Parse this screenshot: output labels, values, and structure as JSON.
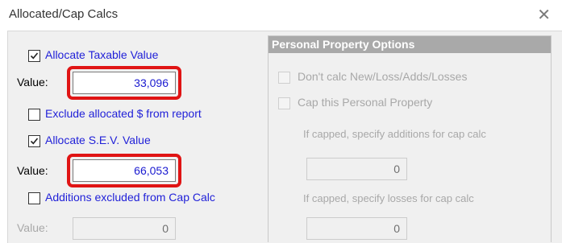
{
  "window": {
    "title": "Allocated/Cap Calcs",
    "close_glyph": "✕"
  },
  "left": {
    "allocate_taxable": {
      "label": "Allocate Taxable Value",
      "checked": true
    },
    "taxable_value": {
      "label": "Value:",
      "value": "33,096"
    },
    "exclude_allocated": {
      "label": "Exclude allocated $ from report",
      "checked": false
    },
    "allocate_sev": {
      "label": "Allocate S.E.V. Value",
      "checked": true
    },
    "sev_value": {
      "label": "Value:",
      "value": "66,053"
    },
    "additions_excluded": {
      "label": "Additions excluded from Cap Calc",
      "checked": false
    },
    "additions_value": {
      "label": "Value:",
      "value": "0"
    }
  },
  "personal_property": {
    "title": "Personal Property Options",
    "dont_calc": {
      "label": "Don't calc New/Loss/Adds/Losses",
      "checked": false
    },
    "cap_this": {
      "label": "Cap this Personal Property",
      "checked": false
    },
    "additions_caption": "If capped, specify additions for cap calc",
    "additions_value": "0",
    "losses_caption": "If capped, specify losses for cap calc",
    "losses_value": "0"
  },
  "colors": {
    "highlight": "#e01414",
    "link_label": "#1f1fd8",
    "group_header": "#a9a9a9"
  }
}
